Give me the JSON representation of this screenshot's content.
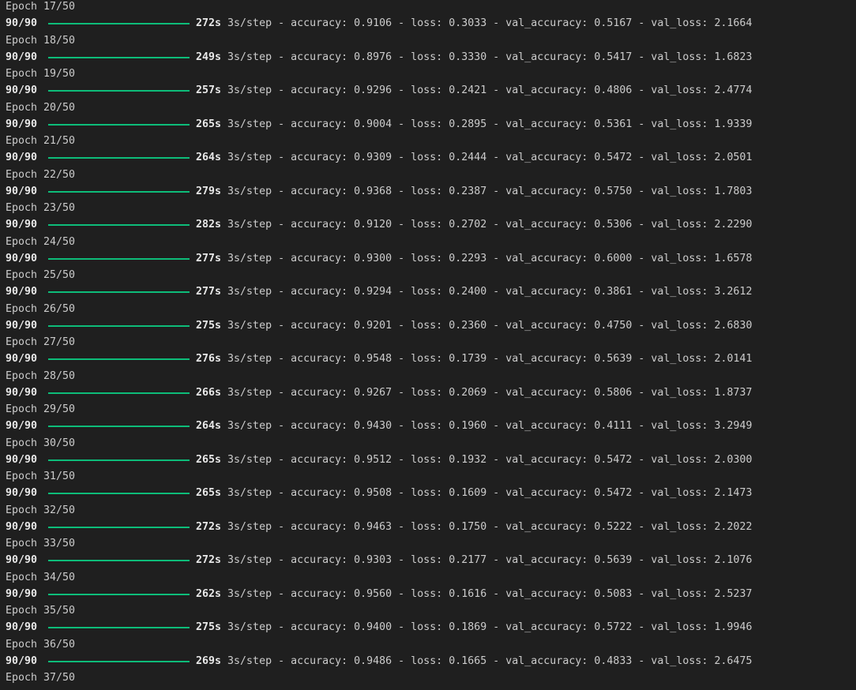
{
  "terminal": {
    "colors": {
      "background": "#1f1f1f",
      "text": "#cccccc",
      "progress": "#0dbc79"
    },
    "rows": [
      {
        "epoch": "Epoch 17/50",
        "steps": "90/90",
        "secs": "272s",
        "rest": " 3s/step - accuracy: 0.9106 - loss: 0.3033 - val_accuracy: 0.5167 - val_loss: 2.1664"
      },
      {
        "epoch": "Epoch 18/50",
        "steps": "90/90",
        "secs": "249s",
        "rest": " 3s/step - accuracy: 0.8976 - loss: 0.3330 - val_accuracy: 0.5417 - val_loss: 1.6823"
      },
      {
        "epoch": "Epoch 19/50",
        "steps": "90/90",
        "secs": "257s",
        "rest": " 3s/step - accuracy: 0.9296 - loss: 0.2421 - val_accuracy: 0.4806 - val_loss: 2.4774"
      },
      {
        "epoch": "Epoch 20/50",
        "steps": "90/90",
        "secs": "265s",
        "rest": " 3s/step - accuracy: 0.9004 - loss: 0.2895 - val_accuracy: 0.5361 - val_loss: 1.9339"
      },
      {
        "epoch": "Epoch 21/50",
        "steps": "90/90",
        "secs": "264s",
        "rest": " 3s/step - accuracy: 0.9309 - loss: 0.2444 - val_accuracy: 0.5472 - val_loss: 2.0501"
      },
      {
        "epoch": "Epoch 22/50",
        "steps": "90/90",
        "secs": "279s",
        "rest": " 3s/step - accuracy: 0.9368 - loss: 0.2387 - val_accuracy: 0.5750 - val_loss: 1.7803"
      },
      {
        "epoch": "Epoch 23/50",
        "steps": "90/90",
        "secs": "282s",
        "rest": " 3s/step - accuracy: 0.9120 - loss: 0.2702 - val_accuracy: 0.5306 - val_loss: 2.2290"
      },
      {
        "epoch": "Epoch 24/50",
        "steps": "90/90",
        "secs": "277s",
        "rest": " 3s/step - accuracy: 0.9300 - loss: 0.2293 - val_accuracy: 0.6000 - val_loss: 1.6578"
      },
      {
        "epoch": "Epoch 25/50",
        "steps": "90/90",
        "secs": "277s",
        "rest": " 3s/step - accuracy: 0.9294 - loss: 0.2400 - val_accuracy: 0.3861 - val_loss: 3.2612"
      },
      {
        "epoch": "Epoch 26/50",
        "steps": "90/90",
        "secs": "275s",
        "rest": " 3s/step - accuracy: 0.9201 - loss: 0.2360 - val_accuracy: 0.4750 - val_loss: 2.6830"
      },
      {
        "epoch": "Epoch 27/50",
        "steps": "90/90",
        "secs": "276s",
        "rest": " 3s/step - accuracy: 0.9548 - loss: 0.1739 - val_accuracy: 0.5639 - val_loss: 2.0141"
      },
      {
        "epoch": "Epoch 28/50",
        "steps": "90/90",
        "secs": "266s",
        "rest": " 3s/step - accuracy: 0.9267 - loss: 0.2069 - val_accuracy: 0.5806 - val_loss: 1.8737"
      },
      {
        "epoch": "Epoch 29/50",
        "steps": "90/90",
        "secs": "264s",
        "rest": " 3s/step - accuracy: 0.9430 - loss: 0.1960 - val_accuracy: 0.4111 - val_loss: 3.2949"
      },
      {
        "epoch": "Epoch 30/50",
        "steps": "90/90",
        "secs": "265s",
        "rest": " 3s/step - accuracy: 0.9512 - loss: 0.1932 - val_accuracy: 0.5472 - val_loss: 2.0300"
      },
      {
        "epoch": "Epoch 31/50",
        "steps": "90/90",
        "secs": "265s",
        "rest": " 3s/step - accuracy: 0.9508 - loss: 0.1609 - val_accuracy: 0.5472 - val_loss: 2.1473"
      },
      {
        "epoch": "Epoch 32/50",
        "steps": "90/90",
        "secs": "272s",
        "rest": " 3s/step - accuracy: 0.9463 - loss: 0.1750 - val_accuracy: 0.5222 - val_loss: 2.2022"
      },
      {
        "epoch": "Epoch 33/50",
        "steps": "90/90",
        "secs": "272s",
        "rest": " 3s/step - accuracy: 0.9303 - loss: 0.2177 - val_accuracy: 0.5639 - val_loss: 2.1076"
      },
      {
        "epoch": "Epoch 34/50",
        "steps": "90/90",
        "secs": "262s",
        "rest": " 3s/step - accuracy: 0.9560 - loss: 0.1616 - val_accuracy: 0.5083 - val_loss: 2.5237"
      },
      {
        "epoch": "Epoch 35/50",
        "steps": "90/90",
        "secs": "275s",
        "rest": " 3s/step - accuracy: 0.9400 - loss: 0.1869 - val_accuracy: 0.5722 - val_loss: 1.9946"
      },
      {
        "epoch": "Epoch 36/50",
        "steps": "90/90",
        "secs": "269s",
        "rest": " 3s/step - accuracy: 0.9486 - loss: 0.1665 - val_accuracy: 0.4833 - val_loss: 2.6475"
      }
    ],
    "last_line": "Epoch 37/50"
  }
}
